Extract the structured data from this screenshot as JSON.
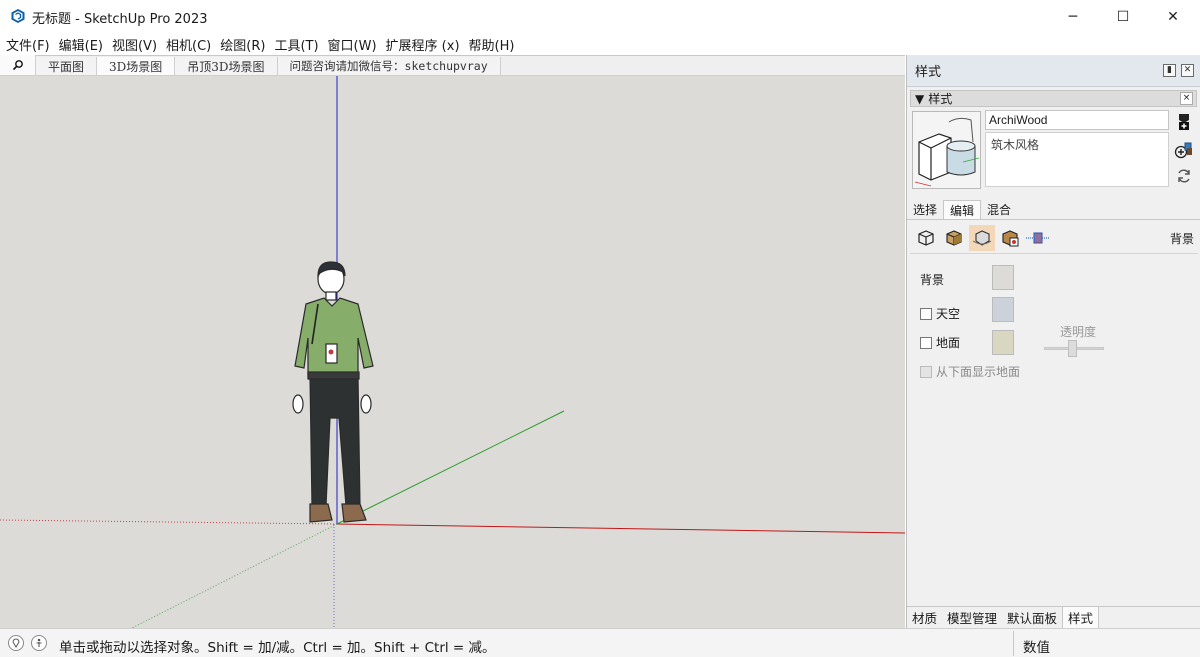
{
  "window": {
    "title": "无标题 - SketchUp Pro 2023",
    "minimize_glyph": "─",
    "maximize_glyph": "☐",
    "close_glyph": "✕"
  },
  "menu": [
    "文件(F)",
    "编辑(E)",
    "视图(V)",
    "相机(C)",
    "绘图(R)",
    "工具(T)",
    "窗口(W)",
    "扩展程序 (x)",
    "帮助(H)"
  ],
  "scenes": {
    "search_icon": "search-icon",
    "tabs": [
      {
        "label": "平面图",
        "active": false
      },
      {
        "label": "3D场景图",
        "active": true
      },
      {
        "label": "吊顶3D场景图",
        "active": false
      },
      {
        "label": "问题咨询请加微信号：sketchupvray",
        "active": false
      }
    ]
  },
  "viewport": {
    "background": "#dcdbd7",
    "axis_colors": {
      "red": "#c01818",
      "green": "#2a9a2a",
      "blue": "#2020c8"
    }
  },
  "panel": {
    "title": "样式",
    "section_title": "样式",
    "style_name": "ArchiWood",
    "style_description": "筑木风格",
    "tabs": [
      {
        "label": "选择",
        "active": false
      },
      {
        "label": "编辑",
        "active": true
      },
      {
        "label": "混合",
        "active": false
      }
    ],
    "edit_section_title": "背景",
    "edit_icons": [
      "edge-settings-icon",
      "face-settings-icon",
      "background-settings-icon",
      "watermark-settings-icon",
      "modeling-settings-icon"
    ],
    "background": {
      "background_label": "背景",
      "background_color": "#dcdbd7",
      "sky_label": "天空",
      "sky_color": "#ccd2da",
      "ground_label": "地面",
      "ground_color": "#d9d6c1",
      "transparency_label": "透明度",
      "show_ground_below_label": "从下面显示地面"
    },
    "bottom_tabs": [
      {
        "label": "材质",
        "active": false
      },
      {
        "label": "模型管理",
        "active": false
      },
      {
        "label": "默认面板",
        "active": false
      },
      {
        "label": "样式",
        "active": true
      }
    ]
  },
  "status": {
    "text": "单击或拖动以选择对象。Shift = 加/减。Ctrl = 加。Shift + Ctrl = 减。",
    "vcb_label": "数值"
  }
}
